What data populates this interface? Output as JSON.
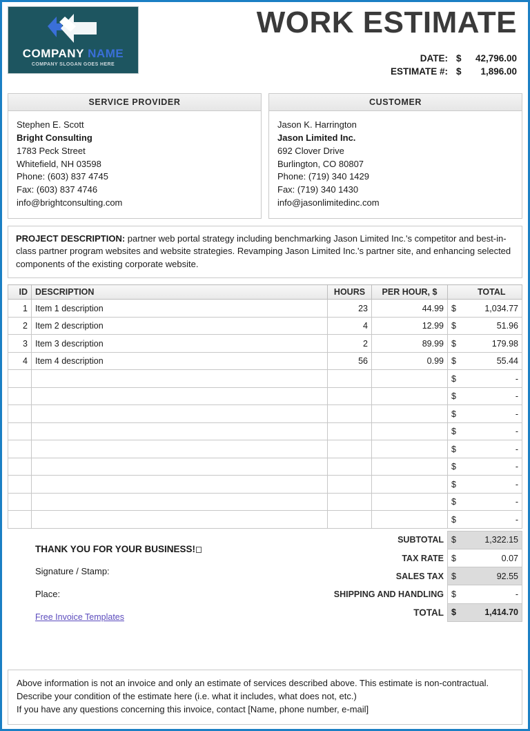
{
  "document": {
    "title": "WORK ESTIMATE"
  },
  "logo": {
    "company_word": "COMPANY",
    "name_word": "NAME",
    "slogan": "COMPANY SLOGAN GOES HERE",
    "box_color": "#1d5560",
    "accent_color": "#3a6fd8"
  },
  "meta": [
    {
      "label": "DATE:",
      "currency": "$",
      "value": "42,796.00"
    },
    {
      "label": "ESTIMATE #:",
      "currency": "$",
      "value": "1,896.00"
    }
  ],
  "service_provider": {
    "heading": "SERVICE PROVIDER",
    "contact_name": "Stephen E. Scott",
    "company": "Bright Consulting",
    "street": "1783 Peck Street",
    "city_state_zip": "Whitefield, NH 03598",
    "phone": "Phone:  (603) 837 4745",
    "fax": "Fax: (603) 837 4746",
    "email": "info@brightconsulting.com"
  },
  "customer": {
    "heading": "CUSTOMER",
    "contact_name": "Jason K. Harrington",
    "company": "Jason Limited Inc.",
    "street": "692 Clover Drive",
    "city_state_zip": "Burlington, CO  80807",
    "phone": "Phone: (719) 340 1429",
    "fax": "Fax: (719) 340 1430",
    "email": "info@jasonlimitedinc.com"
  },
  "project": {
    "label": "PROJECT DESCRIPTION:",
    "text": " partner web portal strategy including benchmarking Jason Limited Inc.'s competitor and best-in-class partner program websites and website strategies. Revamping Jason Limited Inc.'s partner site, and enhancing selected components of the existing corporate website."
  },
  "items_table": {
    "columns": [
      "ID",
      "DESCRIPTION",
      "HOURS",
      "PER HOUR, $",
      "TOTAL"
    ],
    "rows": [
      {
        "id": "1",
        "description": "Item 1 description",
        "hours": "23",
        "rate": "44.99",
        "currency": "$",
        "total": "1,034.77"
      },
      {
        "id": "2",
        "description": "Item 2 description",
        "hours": "4",
        "rate": "12.99",
        "currency": "$",
        "total": "51.96"
      },
      {
        "id": "3",
        "description": "Item 3 description",
        "hours": "2",
        "rate": "89.99",
        "currency": "$",
        "total": "179.98"
      },
      {
        "id": "4",
        "description": "Item 4 description",
        "hours": "56",
        "rate": "0.99",
        "currency": "$",
        "total": "55.44"
      },
      {
        "id": "",
        "description": "",
        "hours": "",
        "rate": "",
        "currency": "$",
        "total": "-"
      },
      {
        "id": "",
        "description": "",
        "hours": "",
        "rate": "",
        "currency": "$",
        "total": "-"
      },
      {
        "id": "",
        "description": "",
        "hours": "",
        "rate": "",
        "currency": "$",
        "total": "-"
      },
      {
        "id": "",
        "description": "",
        "hours": "",
        "rate": "",
        "currency": "$",
        "total": "-"
      },
      {
        "id": "",
        "description": "",
        "hours": "",
        "rate": "",
        "currency": "$",
        "total": "-"
      },
      {
        "id": "",
        "description": "",
        "hours": "",
        "rate": "",
        "currency": "$",
        "total": "-"
      },
      {
        "id": "",
        "description": "",
        "hours": "",
        "rate": "",
        "currency": "$",
        "total": "-"
      },
      {
        "id": "",
        "description": "",
        "hours": "",
        "rate": "",
        "currency": "$",
        "total": "-"
      },
      {
        "id": "",
        "description": "",
        "hours": "",
        "rate": "",
        "currency": "$",
        "total": "-"
      }
    ]
  },
  "totals": [
    {
      "label": "SUBTOTAL",
      "currency": "$",
      "value": "1,322.15",
      "shade": true
    },
    {
      "label": "TAX RATE",
      "currency": "$",
      "value": "0.07",
      "shade": false
    },
    {
      "label": "SALES TAX",
      "currency": "$",
      "value": "92.55",
      "shade": true
    },
    {
      "label": "SHIPPING AND HANDLING",
      "currency": "$",
      "value": "-",
      "shade": false
    },
    {
      "label": "TOTAL",
      "currency": "$",
      "value": "1,414.70",
      "shade": true
    }
  ],
  "footer": {
    "thanks": "THANK YOU FOR YOUR BUSINESS!",
    "signature_label": "Signature / Stamp:",
    "place_label": "Place:",
    "link_text": "Free Invoice Templates"
  },
  "note": {
    "line1": "Above information is not an invoice and only an estimate of services described above. This estimate is non-contractual.",
    "line2": "Describe your condition of the estimate here (i.e. what it includes, what does not, etc.)",
    "line3": "If you have any questions concerning this invoice, contact [Name, phone number, e-mail]"
  }
}
